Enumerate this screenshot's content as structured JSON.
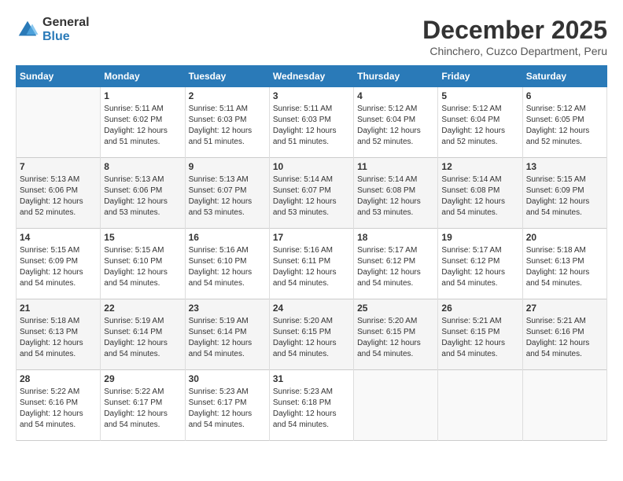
{
  "logo": {
    "general": "General",
    "blue": "Blue"
  },
  "title": "December 2025",
  "subtitle": "Chinchero, Cuzco Department, Peru",
  "days_header": [
    "Sunday",
    "Monday",
    "Tuesday",
    "Wednesday",
    "Thursday",
    "Friday",
    "Saturday"
  ],
  "weeks": [
    [
      {
        "day": "",
        "sunrise": "",
        "sunset": "",
        "daylight": ""
      },
      {
        "day": "1",
        "sunrise": "Sunrise: 5:11 AM",
        "sunset": "Sunset: 6:02 PM",
        "daylight": "Daylight: 12 hours and 51 minutes."
      },
      {
        "day": "2",
        "sunrise": "Sunrise: 5:11 AM",
        "sunset": "Sunset: 6:03 PM",
        "daylight": "Daylight: 12 hours and 51 minutes."
      },
      {
        "day": "3",
        "sunrise": "Sunrise: 5:11 AM",
        "sunset": "Sunset: 6:03 PM",
        "daylight": "Daylight: 12 hours and 51 minutes."
      },
      {
        "day": "4",
        "sunrise": "Sunrise: 5:12 AM",
        "sunset": "Sunset: 6:04 PM",
        "daylight": "Daylight: 12 hours and 52 minutes."
      },
      {
        "day": "5",
        "sunrise": "Sunrise: 5:12 AM",
        "sunset": "Sunset: 6:04 PM",
        "daylight": "Daylight: 12 hours and 52 minutes."
      },
      {
        "day": "6",
        "sunrise": "Sunrise: 5:12 AM",
        "sunset": "Sunset: 6:05 PM",
        "daylight": "Daylight: 12 hours and 52 minutes."
      }
    ],
    [
      {
        "day": "7",
        "sunrise": "Sunrise: 5:13 AM",
        "sunset": "Sunset: 6:06 PM",
        "daylight": "Daylight: 12 hours and 52 minutes."
      },
      {
        "day": "8",
        "sunrise": "Sunrise: 5:13 AM",
        "sunset": "Sunset: 6:06 PM",
        "daylight": "Daylight: 12 hours and 53 minutes."
      },
      {
        "day": "9",
        "sunrise": "Sunrise: 5:13 AM",
        "sunset": "Sunset: 6:07 PM",
        "daylight": "Daylight: 12 hours and 53 minutes."
      },
      {
        "day": "10",
        "sunrise": "Sunrise: 5:14 AM",
        "sunset": "Sunset: 6:07 PM",
        "daylight": "Daylight: 12 hours and 53 minutes."
      },
      {
        "day": "11",
        "sunrise": "Sunrise: 5:14 AM",
        "sunset": "Sunset: 6:08 PM",
        "daylight": "Daylight: 12 hours and 53 minutes."
      },
      {
        "day": "12",
        "sunrise": "Sunrise: 5:14 AM",
        "sunset": "Sunset: 6:08 PM",
        "daylight": "Daylight: 12 hours and 54 minutes."
      },
      {
        "day": "13",
        "sunrise": "Sunrise: 5:15 AM",
        "sunset": "Sunset: 6:09 PM",
        "daylight": "Daylight: 12 hours and 54 minutes."
      }
    ],
    [
      {
        "day": "14",
        "sunrise": "Sunrise: 5:15 AM",
        "sunset": "Sunset: 6:09 PM",
        "daylight": "Daylight: 12 hours and 54 minutes."
      },
      {
        "day": "15",
        "sunrise": "Sunrise: 5:15 AM",
        "sunset": "Sunset: 6:10 PM",
        "daylight": "Daylight: 12 hours and 54 minutes."
      },
      {
        "day": "16",
        "sunrise": "Sunrise: 5:16 AM",
        "sunset": "Sunset: 6:10 PM",
        "daylight": "Daylight: 12 hours and 54 minutes."
      },
      {
        "day": "17",
        "sunrise": "Sunrise: 5:16 AM",
        "sunset": "Sunset: 6:11 PM",
        "daylight": "Daylight: 12 hours and 54 minutes."
      },
      {
        "day": "18",
        "sunrise": "Sunrise: 5:17 AM",
        "sunset": "Sunset: 6:12 PM",
        "daylight": "Daylight: 12 hours and 54 minutes."
      },
      {
        "day": "19",
        "sunrise": "Sunrise: 5:17 AM",
        "sunset": "Sunset: 6:12 PM",
        "daylight": "Daylight: 12 hours and 54 minutes."
      },
      {
        "day": "20",
        "sunrise": "Sunrise: 5:18 AM",
        "sunset": "Sunset: 6:13 PM",
        "daylight": "Daylight: 12 hours and 54 minutes."
      }
    ],
    [
      {
        "day": "21",
        "sunrise": "Sunrise: 5:18 AM",
        "sunset": "Sunset: 6:13 PM",
        "daylight": "Daylight: 12 hours and 54 minutes."
      },
      {
        "day": "22",
        "sunrise": "Sunrise: 5:19 AM",
        "sunset": "Sunset: 6:14 PM",
        "daylight": "Daylight: 12 hours and 54 minutes."
      },
      {
        "day": "23",
        "sunrise": "Sunrise: 5:19 AM",
        "sunset": "Sunset: 6:14 PM",
        "daylight": "Daylight: 12 hours and 54 minutes."
      },
      {
        "day": "24",
        "sunrise": "Sunrise: 5:20 AM",
        "sunset": "Sunset: 6:15 PM",
        "daylight": "Daylight: 12 hours and 54 minutes."
      },
      {
        "day": "25",
        "sunrise": "Sunrise: 5:20 AM",
        "sunset": "Sunset: 6:15 PM",
        "daylight": "Daylight: 12 hours and 54 minutes."
      },
      {
        "day": "26",
        "sunrise": "Sunrise: 5:21 AM",
        "sunset": "Sunset: 6:15 PM",
        "daylight": "Daylight: 12 hours and 54 minutes."
      },
      {
        "day": "27",
        "sunrise": "Sunrise: 5:21 AM",
        "sunset": "Sunset: 6:16 PM",
        "daylight": "Daylight: 12 hours and 54 minutes."
      }
    ],
    [
      {
        "day": "28",
        "sunrise": "Sunrise: 5:22 AM",
        "sunset": "Sunset: 6:16 PM",
        "daylight": "Daylight: 12 hours and 54 minutes."
      },
      {
        "day": "29",
        "sunrise": "Sunrise: 5:22 AM",
        "sunset": "Sunset: 6:17 PM",
        "daylight": "Daylight: 12 hours and 54 minutes."
      },
      {
        "day": "30",
        "sunrise": "Sunrise: 5:23 AM",
        "sunset": "Sunset: 6:17 PM",
        "daylight": "Daylight: 12 hours and 54 minutes."
      },
      {
        "day": "31",
        "sunrise": "Sunrise: 5:23 AM",
        "sunset": "Sunset: 6:18 PM",
        "daylight": "Daylight: 12 hours and 54 minutes."
      },
      {
        "day": "",
        "sunrise": "",
        "sunset": "",
        "daylight": ""
      },
      {
        "day": "",
        "sunrise": "",
        "sunset": "",
        "daylight": ""
      },
      {
        "day": "",
        "sunrise": "",
        "sunset": "",
        "daylight": ""
      }
    ]
  ]
}
